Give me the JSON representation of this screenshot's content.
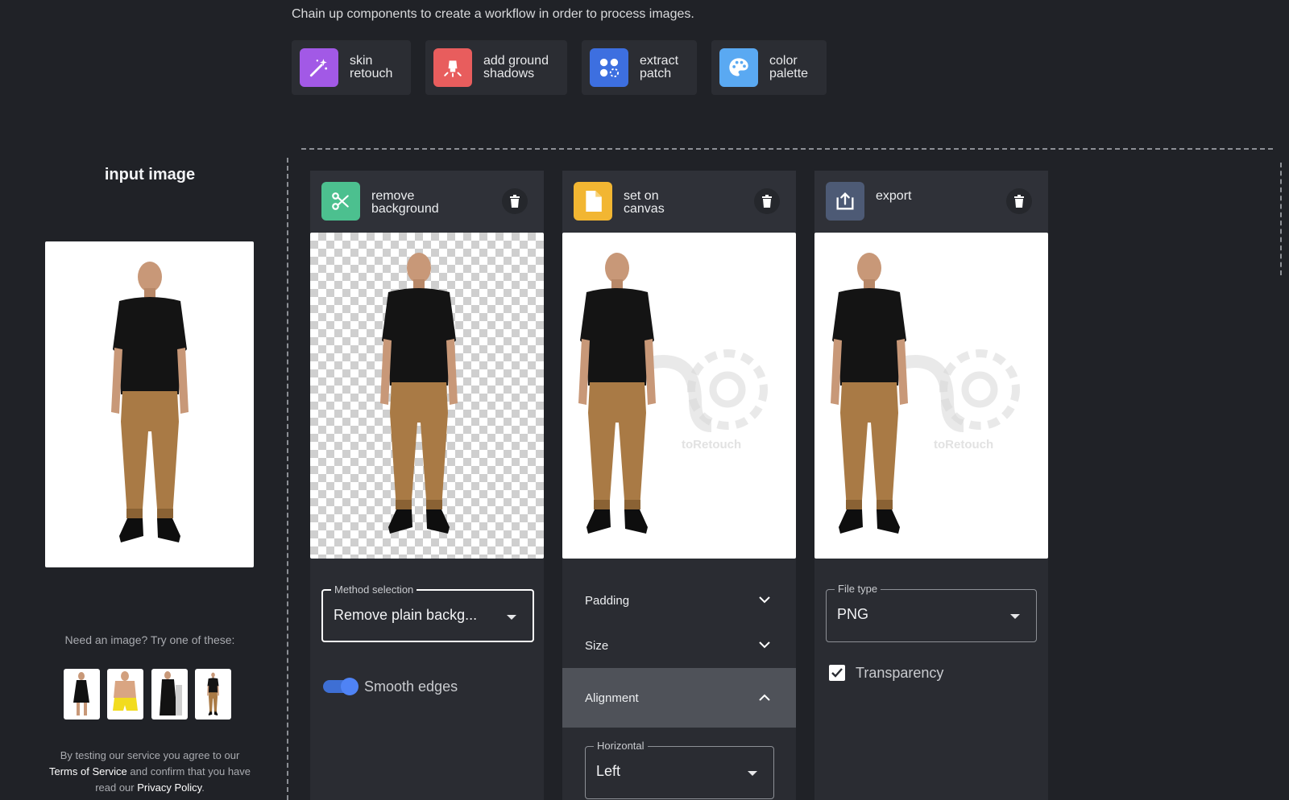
{
  "header": {
    "subtitle": "Chain up components to create a workflow in order to process images."
  },
  "components": [
    {
      "label": "skin\nretouch",
      "icon": "magic-wand-icon",
      "color": "#a259e6"
    },
    {
      "label": "add ground\nshadows",
      "icon": "lamp-icon",
      "color": "#e85d5d"
    },
    {
      "label": "extract\npatch",
      "icon": "dots-icon",
      "color": "#3d6fe0"
    },
    {
      "label": "color\npalette",
      "icon": "palette-icon",
      "color": "#5aa9f2"
    }
  ],
  "input": {
    "title": "input image",
    "need_text": "Need an image? Try one of these:",
    "legal_prefix": "By testing our service you agree to our",
    "terms_link": "Terms of Service",
    "legal_mid": "and confirm that you have read our",
    "privacy_link": "Privacy Policy",
    "legal_end": "."
  },
  "steps": [
    {
      "title": "remove\nbackground",
      "icon": "scissors-icon",
      "color": "#4cc08f",
      "method_label": "Method selection",
      "method_value": "Remove plain backg...",
      "toggle_label": "Smooth edges",
      "toggle_on": true
    },
    {
      "title": "set on\ncanvas",
      "icon": "document-icon",
      "color": "#f2b632",
      "watermark": "toRetouch",
      "sections": [
        "Padding",
        "Size",
        "Alignment"
      ],
      "horizontal_label": "Horizontal",
      "horizontal_value": "Left"
    },
    {
      "title": "export",
      "icon": "export-icon",
      "color": "#4d5a75",
      "watermark": "toRetouch",
      "filetype_label": "File type",
      "filetype_value": "PNG",
      "transparency_label": "Transparency",
      "transparency_checked": true
    }
  ]
}
